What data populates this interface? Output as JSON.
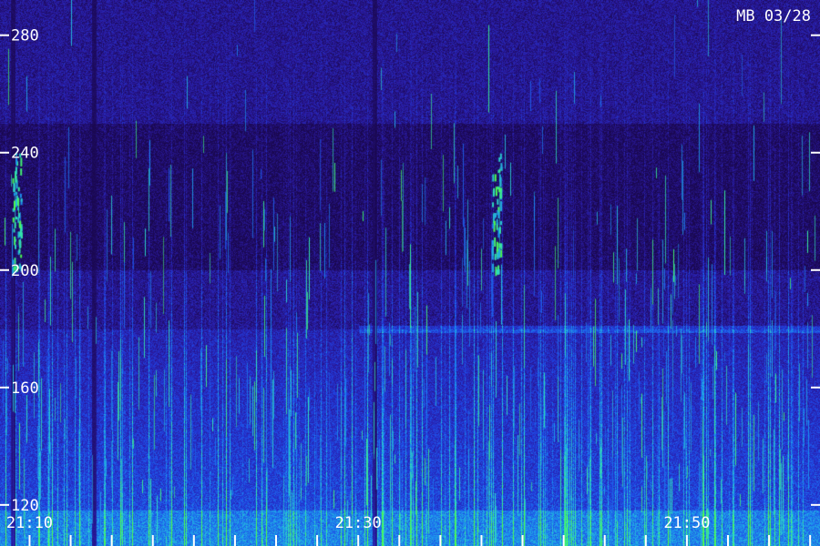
{
  "chart_data": {
    "type": "heatmap",
    "title": "MB 03/28",
    "y_tick_labels": [
      "280",
      "240",
      "200",
      "160",
      "120"
    ],
    "y_ticks": [
      280,
      240,
      200,
      160,
      120
    ],
    "ylim": [
      106,
      292
    ],
    "x_tick_labels": [
      "21:10",
      "21:30",
      "21:50"
    ],
    "x_ticks_minutes": [
      10,
      30,
      50
    ],
    "xlim_minutes": [
      8.2,
      58.1
    ],
    "minor_tick_interval_minutes": 2.5,
    "colormap": [
      "#1a0850",
      "#2a1aa0",
      "#2040e0",
      "#1c90f0",
      "#30e0c0",
      "#50ff40"
    ],
    "features": {
      "background_color": "#1a0850",
      "dark_band_range": [
        200,
        250
      ],
      "horizontal_band_value": 180,
      "horizontal_band_start_minutes": 30.0,
      "vertical_dark_lines_minutes": [
        9.0,
        13.9,
        31.0
      ],
      "bright_burst_minutes": [
        9.2,
        38.4
      ],
      "bright_burst_range": [
        200,
        240
      ]
    }
  }
}
